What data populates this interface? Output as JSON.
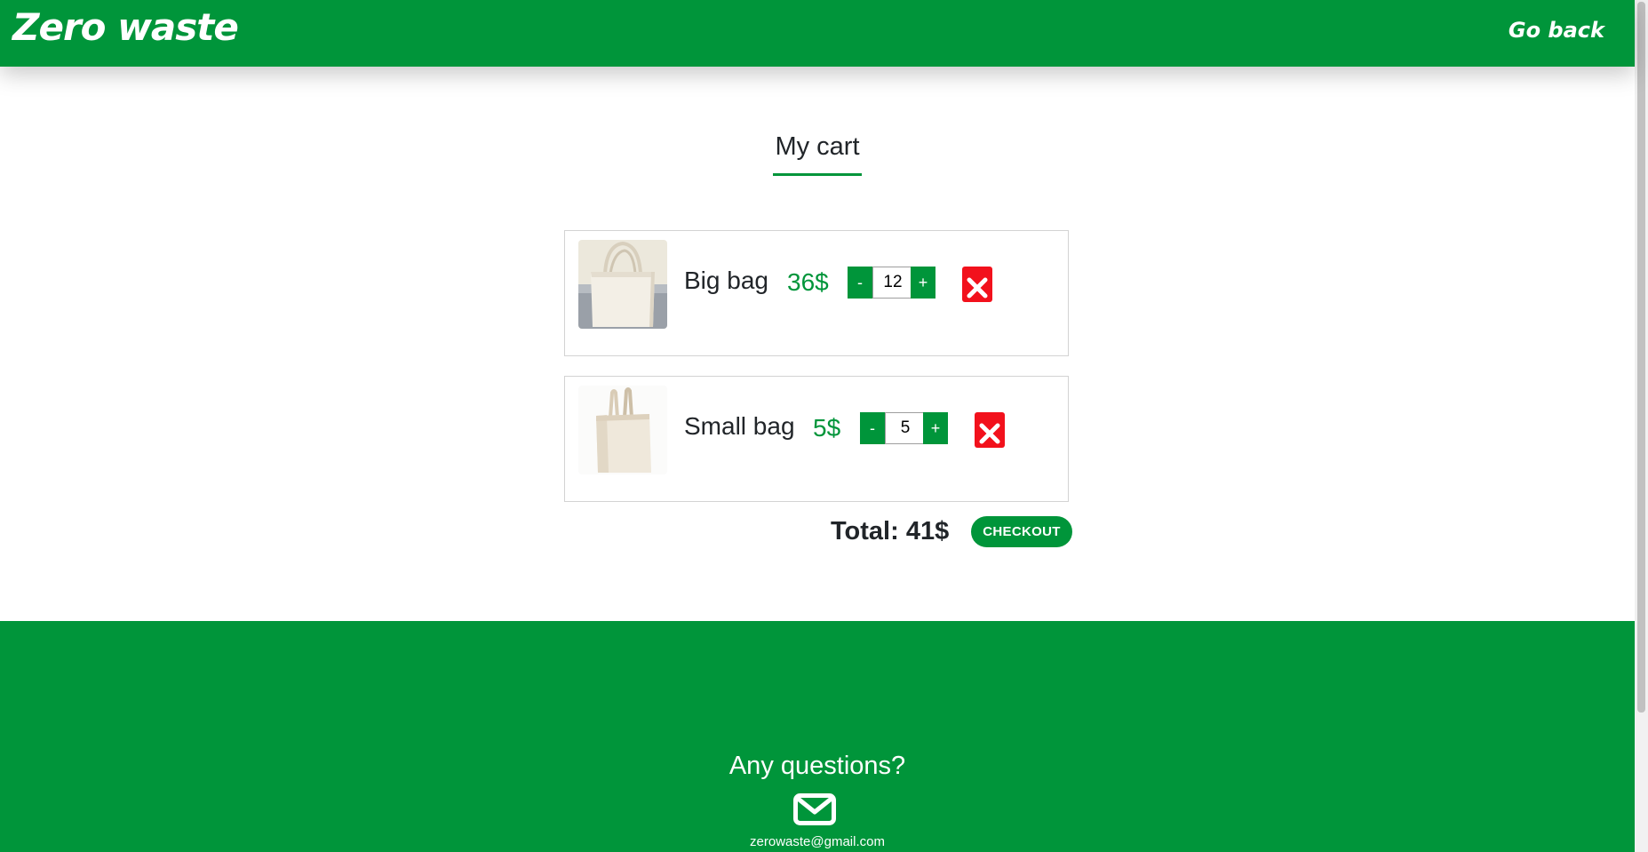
{
  "header": {
    "logo": "Zero waste",
    "go_back": "Go back"
  },
  "cart": {
    "title": "My cart",
    "items": [
      {
        "name": "Big bag",
        "price": "36$",
        "quantity": "12",
        "minus": "-",
        "plus": "+",
        "image": "tote-bag-photo"
      },
      {
        "name": "Small bag",
        "price": "5$",
        "quantity": "5",
        "minus": "-",
        "plus": "+",
        "image": "small-tote-bag-photo"
      }
    ],
    "total": "Total: 41$",
    "checkout": "CHECKOUT"
  },
  "footer": {
    "question": "Any questions?",
    "email_icon": "envelope-icon",
    "email": "zerowaste@gmail.com"
  },
  "colors": {
    "brand_green": "#00953a",
    "remove_red": "#f2111c"
  }
}
